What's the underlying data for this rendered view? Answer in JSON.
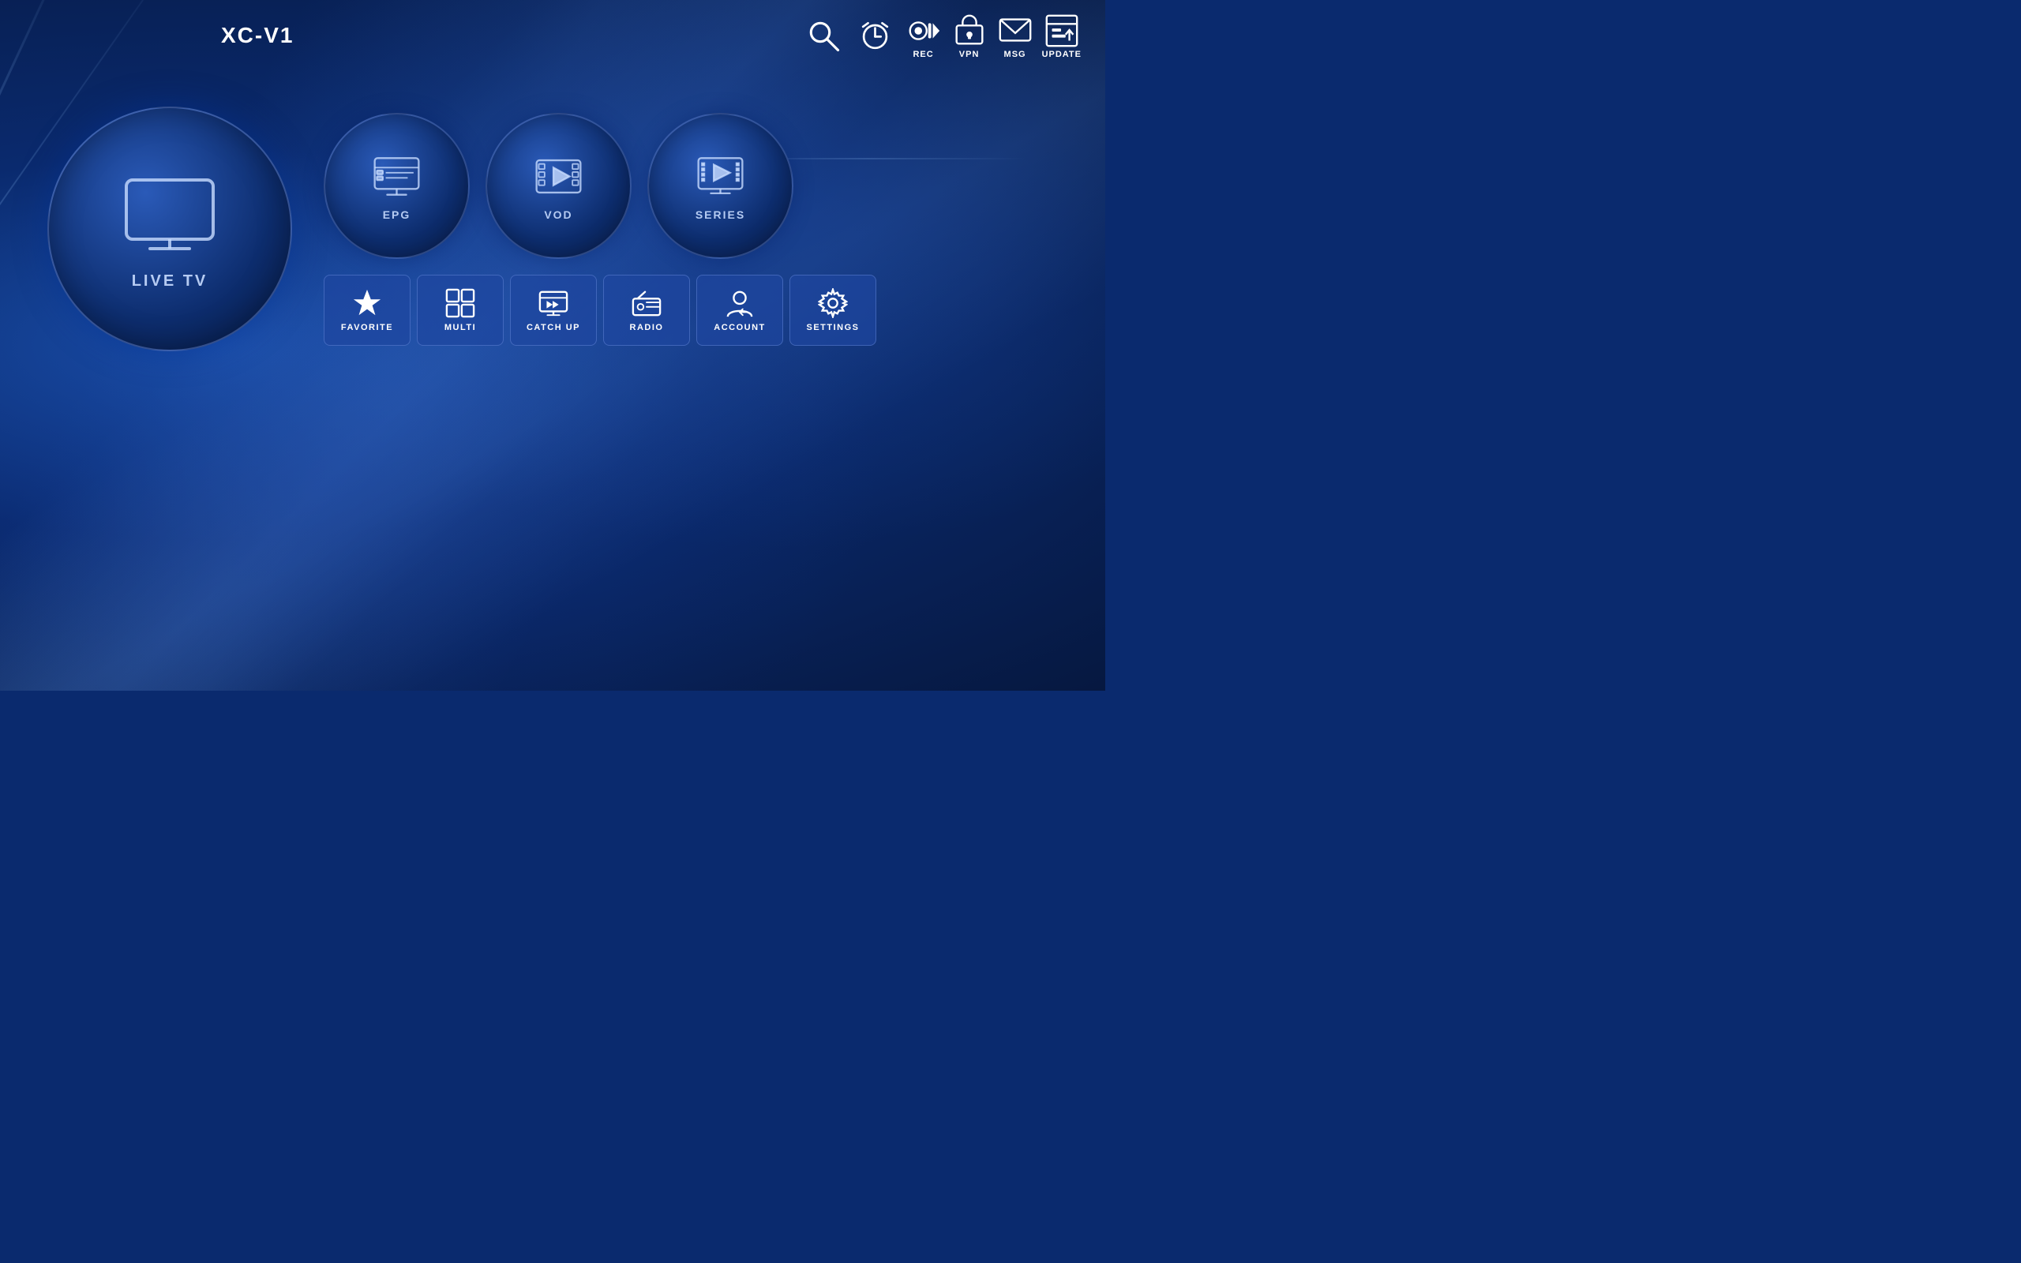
{
  "app": {
    "title": "XC-V1"
  },
  "toolbar": {
    "search_label": "search",
    "alarm_label": "alarm",
    "rec_label": "REC",
    "vpn_label": "VPN",
    "msg_label": "MSG",
    "update_label": "UPDATE"
  },
  "live_tv": {
    "label": "LIVE TV"
  },
  "menu_circles": [
    {
      "id": "epg",
      "label": "EPG"
    },
    {
      "id": "vod",
      "label": "VOD"
    },
    {
      "id": "series",
      "label": "SERIES"
    }
  ],
  "menu_buttons": [
    {
      "id": "favorite",
      "label": "FAVORITE"
    },
    {
      "id": "multi",
      "label": "MULTI"
    },
    {
      "id": "catchup",
      "label": "CATCH UP"
    },
    {
      "id": "radio",
      "label": "RADIO"
    },
    {
      "id": "account",
      "label": "ACCOUNT"
    },
    {
      "id": "settings",
      "label": "SETTINGS"
    }
  ]
}
